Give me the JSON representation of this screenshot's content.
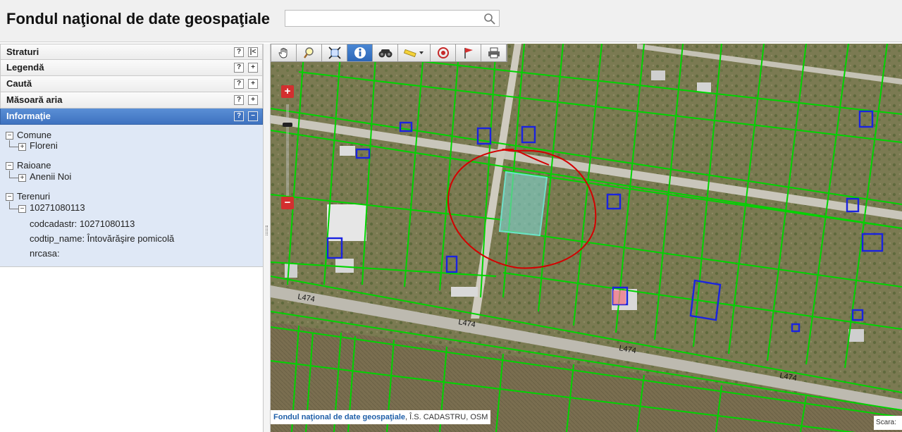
{
  "header": {
    "title": "Fondul naţional de date geospaţiale",
    "search_placeholder": ""
  },
  "panels": [
    {
      "label": "Straturi"
    },
    {
      "label": "Legendă"
    },
    {
      "label": "Caută"
    },
    {
      "label": "Măsoară aria"
    },
    {
      "label": "Informaţie"
    }
  ],
  "tree": {
    "comune": "Comune",
    "floreni": "Floreni",
    "raioane": "Raioane",
    "anenii": "Anenii Noi",
    "terenuri": "Terenuri",
    "parcel": "10271080113",
    "codcadastr": "codcadastr: 10271080113",
    "codtip": "codtip_name: Întovărăşire pomicolă",
    "nrcasa": "nrcasa:"
  },
  "map": {
    "road_labels": [
      "L474",
      "L474",
      "L474",
      "L474"
    ],
    "attribution_main": "Fondul naţional de date geospaţiale",
    "attribution_rest": ", Î.S. CADASTRU, OSM",
    "scale_label": "Scara:"
  },
  "toolbar": [
    "hand-icon",
    "zoom-box-icon",
    "full-extent-icon",
    "info-icon",
    "binoculars-icon",
    "measure-icon",
    "target-icon",
    "flag-icon",
    "print-icon"
  ],
  "colors": {
    "accent": "#3e72c0",
    "parcel": "#00d000",
    "building": "#1a23e0",
    "selection": "#7fd6d0",
    "annotation": "#d40000"
  }
}
